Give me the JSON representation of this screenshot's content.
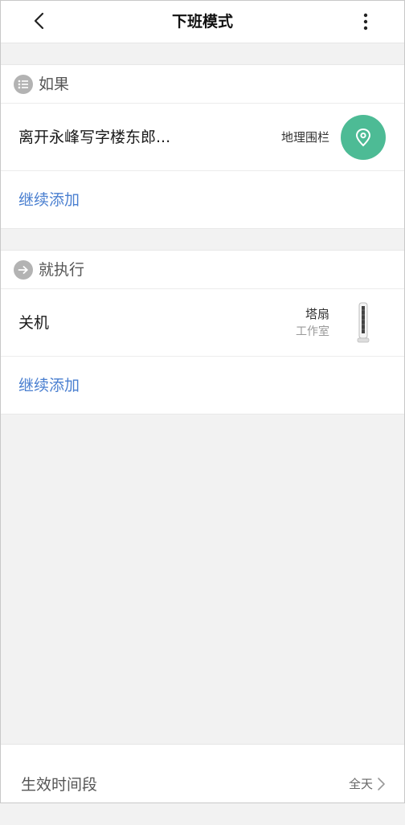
{
  "header": {
    "title": "下班模式",
    "back_icon": "chevron-left-icon",
    "more_icon": "more-vertical-icon"
  },
  "condition_section": {
    "title": "如果",
    "icon": "list-icon",
    "item": {
      "label": "离开永峰写字楼东郎...",
      "type": "地理围栏",
      "icon": "location-pin-icon"
    },
    "add_label": "继续添加"
  },
  "action_section": {
    "title": "就执行",
    "icon": "arrow-right-icon",
    "item": {
      "label": "关机",
      "device": "塔扇",
      "room": "工作室",
      "icon": "tower-fan-icon"
    },
    "add_label": "继续添加"
  },
  "footer": {
    "label": "生效时间段",
    "value": "全天",
    "icon": "chevron-right-icon"
  },
  "colors": {
    "accent_green": "#4dbb95",
    "link_blue": "#4a7fd0",
    "background": "#f2f2f2"
  }
}
